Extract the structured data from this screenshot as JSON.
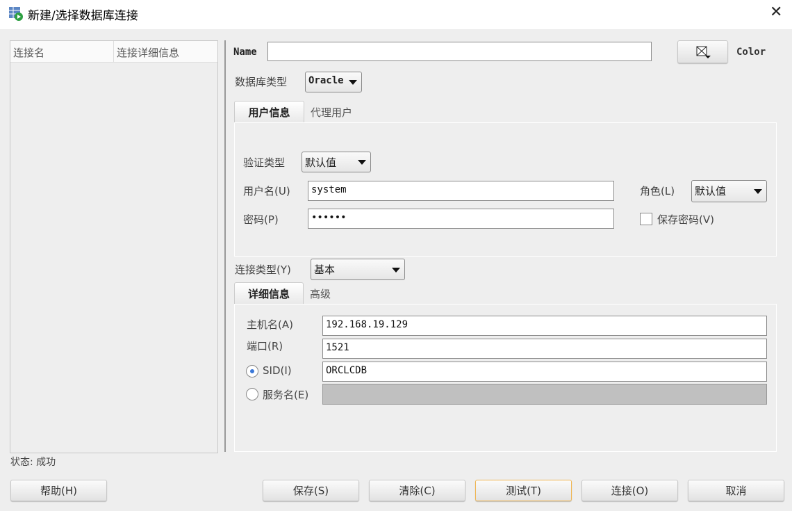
{
  "window": {
    "title": "新建/选择数据库连接",
    "close": "✕"
  },
  "connections_table": {
    "columns": [
      "连接名",
      "连接详细信息"
    ],
    "rows": []
  },
  "form": {
    "name_label": "Name",
    "name_value": "",
    "color_label": "Color",
    "db_type_label": "数据库类型",
    "db_type_value": "Oracle",
    "user_tabs": [
      "用户信息",
      "代理用户"
    ],
    "auth_type_label": "验证类型",
    "auth_type_value": "默认值",
    "username_label": "用户名(U)",
    "username_value": "system",
    "password_label": "密码(P)",
    "password_value": "••••••",
    "role_label": "角色(L)",
    "role_value": "默认值",
    "save_password_label": "保存密码(V)",
    "save_password_checked": false,
    "conn_type_label": "连接类型(Y)",
    "conn_type_value": "基本",
    "detail_tabs": [
      "详细信息",
      "高级"
    ],
    "host_label": "主机名(A)",
    "host_value": "192.168.19.129",
    "port_label": "端口(R)",
    "port_value": "1521",
    "sid_label": "SID(I)",
    "sid_value": "ORCLCDB",
    "sid_selected": true,
    "service_label": "服务名(E)",
    "service_value": ""
  },
  "status": "状态: 成功",
  "buttons": {
    "help": "帮助(H)",
    "save": "保存(S)",
    "clear": "清除(C)",
    "test": "测试(T)",
    "connect": "连接(O)",
    "cancel": "取消"
  }
}
